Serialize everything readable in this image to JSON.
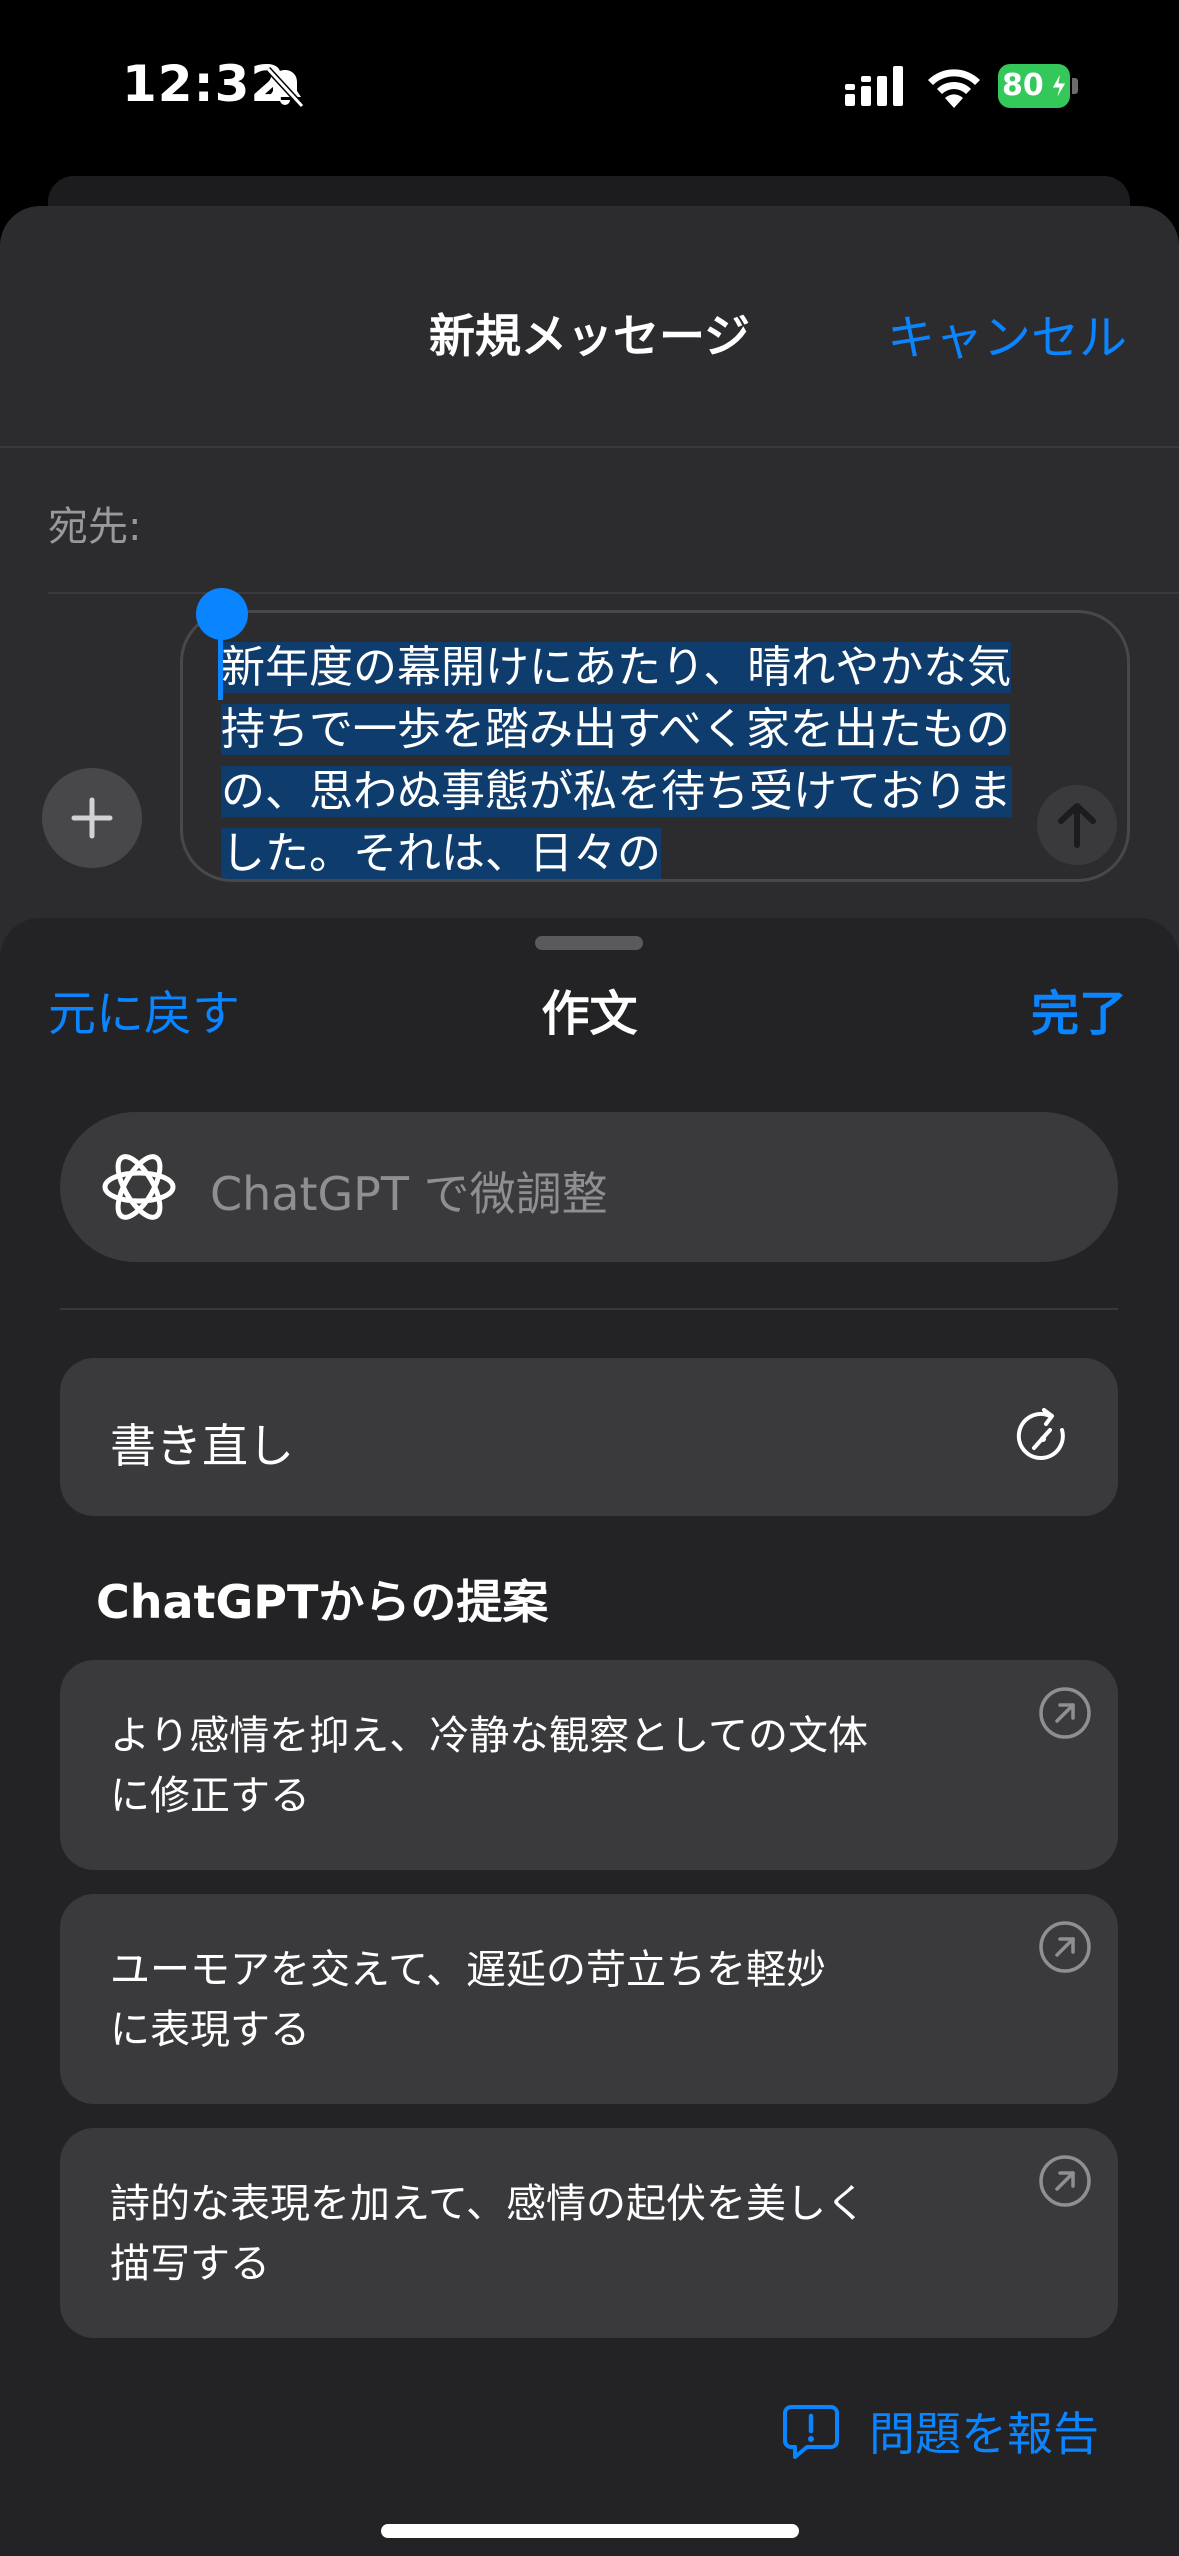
{
  "status_bar": {
    "time": "12:32",
    "battery_percent": "80",
    "icons": [
      "bell-slash-icon",
      "cellular-signal-icon",
      "wifi-icon",
      "battery-charging-icon"
    ]
  },
  "compose": {
    "title": "新規メッセージ",
    "cancel_label": "キャンセル",
    "to_label": "宛先:",
    "message_text": "新年度の幕開けにあたり、晴れやかな気持ちで一歩を踏み出すべく家を出たものの、思わぬ事態が私を待ち受けておりました。それは、日々の"
  },
  "writing_tools": {
    "undo_label": "元に戻す",
    "title": "作文",
    "done_label": "完了",
    "chatgpt_placeholder": "ChatGPT で微調整",
    "rewrite_label": "書き直し",
    "suggestions_heading": "ChatGPTからの提案",
    "suggestions": [
      {
        "line1": "より感情を抑え、冷静な観察としての文体",
        "line2": "に修正する"
      },
      {
        "line1": "ユーモアを交えて、遅延の苛立ちを軽妙",
        "line2": "に表現する"
      },
      {
        "line1": "詩的な表現を加えて、感情の起伏を美しく",
        "line2": "描写する"
      }
    ],
    "report_label": "問題を報告"
  },
  "colors": {
    "accent": "#0a84ff",
    "sheet_bg": "#2c2c2e",
    "panel_bg": "#232325",
    "card_bg": "#3a3a3c",
    "selection": "#0e3c6d",
    "battery": "#34c759"
  }
}
